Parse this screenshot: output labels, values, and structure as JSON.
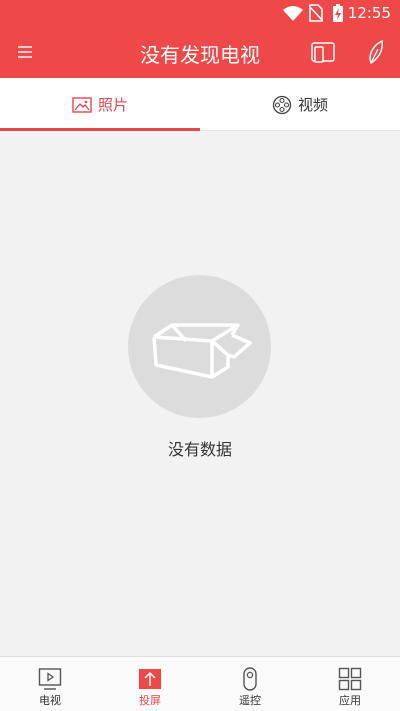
{
  "status_bar": {
    "time": "12:55"
  },
  "header": {
    "title": "没有发现电视"
  },
  "tabs": [
    {
      "label": "照片",
      "icon": "image-icon",
      "active": true
    },
    {
      "label": "视频",
      "icon": "film-reel-icon",
      "active": false
    }
  ],
  "empty_state": {
    "text": "没有数据",
    "icon": "empty-box-icon"
  },
  "bottom_nav": [
    {
      "label": "电视",
      "icon": "tv-play-icon",
      "active": false
    },
    {
      "label": "投屏",
      "icon": "cast-upload-icon",
      "active": true
    },
    {
      "label": "遥控",
      "icon": "remote-icon",
      "active": false
    },
    {
      "label": "应用",
      "icon": "apps-grid-icon",
      "active": false
    }
  ],
  "colors": {
    "accent": "#ef4848",
    "tab_active": "#e5474b",
    "background": "#f2f2f2"
  }
}
